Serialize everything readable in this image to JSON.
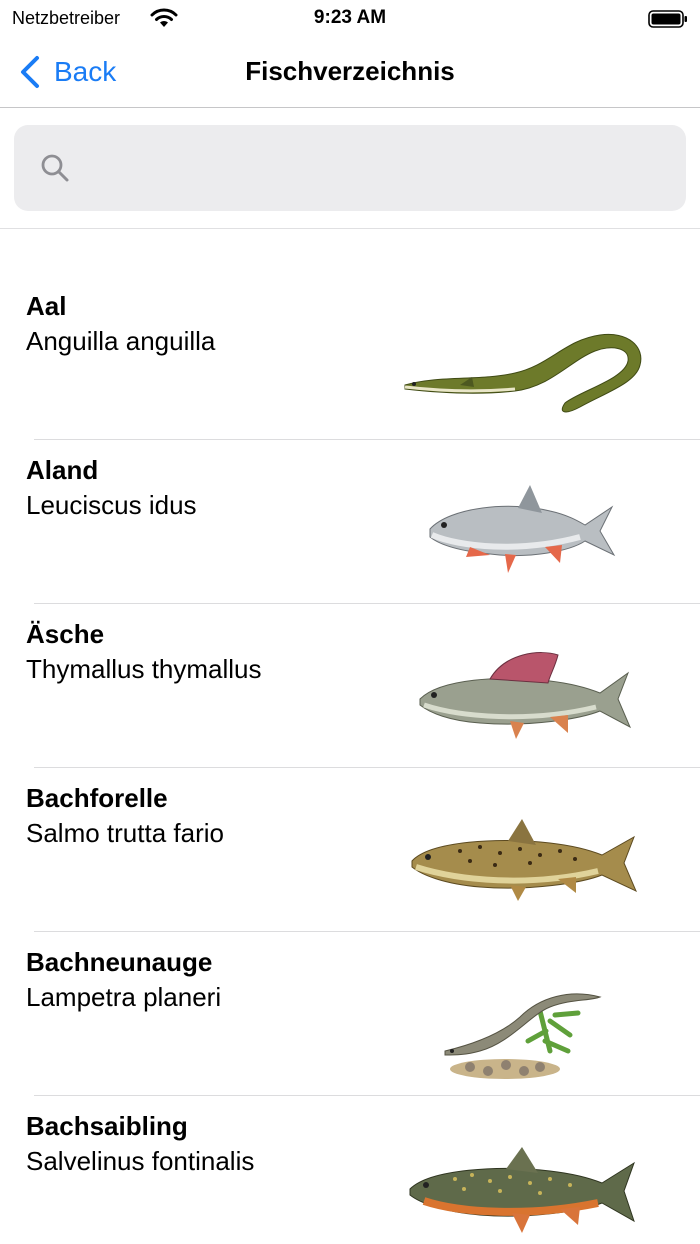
{
  "status_bar": {
    "carrier": "Netzbetreiber",
    "time": "9:23 AM",
    "icons": [
      "wifi-icon",
      "battery-icon"
    ]
  },
  "nav": {
    "back_label": "Back",
    "title": "Fischverzeichnis"
  },
  "search": {
    "value": "",
    "icon": "search-icon"
  },
  "fish": [
    {
      "name": "Aal",
      "latin": "Anguilla anguilla",
      "image": "eel-illustration"
    },
    {
      "name": "Aland",
      "latin": "Leuciscus idus",
      "image": "ide-fish-illustration"
    },
    {
      "name": "Äsche",
      "latin": "Thymallus thymallus",
      "image": "grayling-fish-illustration"
    },
    {
      "name": "Bachforelle",
      "latin": "Salmo trutta fario",
      "image": "brown-trout-illustration"
    },
    {
      "name": "Bachneunauge",
      "latin": "Lampetra planeri",
      "image": "brook-lamprey-illustration"
    },
    {
      "name": "Bachsaibling",
      "latin": "Salvelinus fontinalis",
      "image": "brook-trout-illustration"
    }
  ],
  "colors": {
    "accent": "#1a7cf5",
    "search_bg": "#ececee",
    "separator": "#dcdcde"
  }
}
